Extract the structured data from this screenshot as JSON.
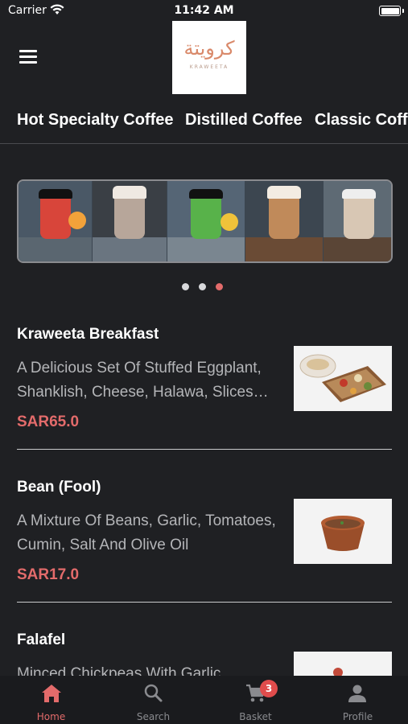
{
  "status": {
    "carrier": "Carrier",
    "time": "11:42 AM"
  },
  "logo": {
    "arabic": "كرويتة",
    "latin": "KRAWEETA"
  },
  "categories": [
    "Hot Specialty Coffee",
    "Distilled Coffee",
    "Classic Coffee"
  ],
  "carousel": {
    "slide_count": 3,
    "active_index": 2
  },
  "items": [
    {
      "name": "Kraweeta Breakfast",
      "description": "A Delicious Set Of Stuffed Eggplant, Shanklish, Cheese, Halawa, Slices…",
      "price": "SAR65.0"
    },
    {
      "name": "Bean (Fool)",
      "description": "A Mixture Of Beans, Garlic, Tomatoes, Cumin, Salt And Olive Oil",
      "price": "SAR17.0"
    },
    {
      "name": "Falafel",
      "description": "Minced Chickpeas With Garlic",
      "price": ""
    }
  ],
  "tabs": [
    {
      "label": "Home",
      "icon": "home-icon",
      "active": true
    },
    {
      "label": "Search",
      "icon": "search-icon",
      "active": false
    },
    {
      "label": "Basket",
      "icon": "cart-icon",
      "active": false
    },
    {
      "label": "Profile",
      "icon": "person-icon",
      "active": false
    }
  ],
  "basket_count": "3",
  "colors": {
    "accent": "#e36b6b",
    "background": "#1f2023",
    "badge": "#e04c4c"
  }
}
